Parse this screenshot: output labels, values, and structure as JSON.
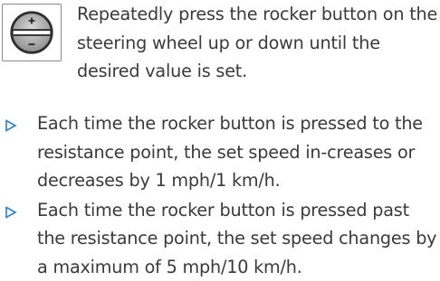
{
  "instruction": {
    "icon": "rocker-button-icon",
    "text": "Repeatedly press the rocker button on the steering wheel up or down until the desired value is set."
  },
  "bullets": [
    {
      "marker": "triangle-bullet-icon",
      "text": "Each time the rocker button is pressed to the resistance point, the set speed in-creases or decreases by 1 mph/1 km/h."
    },
    {
      "marker": "triangle-bullet-icon",
      "text": "Each time the rocker button is pressed past the resistance point, the set speed changes by a maximum of 5 mph/10 km/h."
    }
  ],
  "colors": {
    "text": "#3a3a3a",
    "accent": "#2f7fc0",
    "icon_border": "#8a8a8a"
  }
}
